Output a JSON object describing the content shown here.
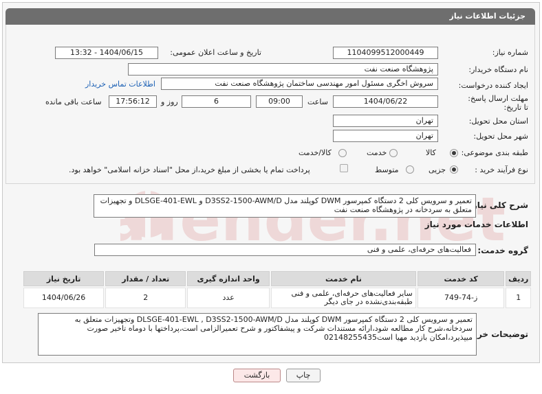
{
  "header": {
    "title": "جزئیات اطلاعات نیاز"
  },
  "fields": {
    "need_number_label": "شماره نیاز:",
    "need_number": "1104099512000449",
    "announce_label": "تاریخ و ساعت اعلان عمومی:",
    "announce_value": "1404/06/15 - 13:32",
    "buyer_org_label": "نام دستگاه خریدار:",
    "buyer_org": "پژوهشگاه صنعت نفت",
    "creator_label": "ایجاد کننده درخواست:",
    "creator": "سروش اخگری مسئول امور مهندسی ساختمان پژوهشگاه صنعت نفت",
    "contact_link": "اطلاعات تماس خریدار",
    "deadline_label": "مهلت ارسال پاسخ: تا تاریخ:",
    "deadline_date": "1404/06/22",
    "time_label": "ساعت",
    "deadline_time": "09:00",
    "days_value": "6",
    "days_label": "روز و",
    "remaining_time": "17:56:12",
    "remaining_label": "ساعت باقی مانده",
    "province_label": "استان محل تحویل:",
    "province": "تهران",
    "city_label": "شهر محل تحویل:",
    "city": "تهران",
    "category_label": "طبقه بندی موضوعی:",
    "category_options": [
      "کالا",
      "خدمت",
      "کالا/خدمت"
    ],
    "purchase_type_label": "نوع فرآیند خرید :",
    "purchase_options": [
      "جزیی",
      "متوسط"
    ],
    "treasury_note": "پرداخت تمام یا بخشی از مبلغ خرید،از محل \"اسناد خزانه اسلامی\" خواهد بود."
  },
  "description": {
    "label": "شرح کلی نیاز:",
    "text": "تعمیر و سرویس کلی 2 دستگاه کمپرسور DWM کوپلند مدل D3SS2-1500-AWM/D و DLSGE-401-EWL و تجهیزات متعلق به سردخانه در پژوهشگاه صنعت نفت"
  },
  "services": {
    "section_title": "اطلاعات خدمات مورد نیاز",
    "group_label": "گروه خدمت:",
    "group_value": "فعالیت‌های حرفه‌ای، علمی و فنی",
    "columns": [
      "ردیف",
      "کد خدمت",
      "نام خدمت",
      "واحد اندازه گیری",
      "تعداد / مقدار",
      "تاریخ نیاز"
    ],
    "rows": [
      {
        "index": "1",
        "code": "ز-74-749",
        "name": "سایر فعالیت‌های حرفه‌ای، علمی و فنی طبقه‌بندی‌نشده در جای دیگر",
        "unit": "عدد",
        "qty": "2",
        "date": "1404/06/26"
      }
    ]
  },
  "buyer_notes": {
    "label": "توضیحات خریدار:",
    "text": "تعمیر و سرویس کلی 2 دستگاه کمپرسور DWM کوپلند مدل DLSGE-401-EWL , D3SS2-1500-AWM/D وتجهیزات متعلق به سردخانه،شرح کار مطالعه شود،ارائه مستندات شرکت و پیشفاکتور و شرح تعمیرالزامی است،پرداختها با دوماه تاخیر صورت میپذیرد،امکان بازدید مهیا است02148255435"
  },
  "buttons": {
    "print": "چاپ",
    "back": "بازگشت"
  },
  "watermark": {
    "text": "AriaTender.net"
  }
}
